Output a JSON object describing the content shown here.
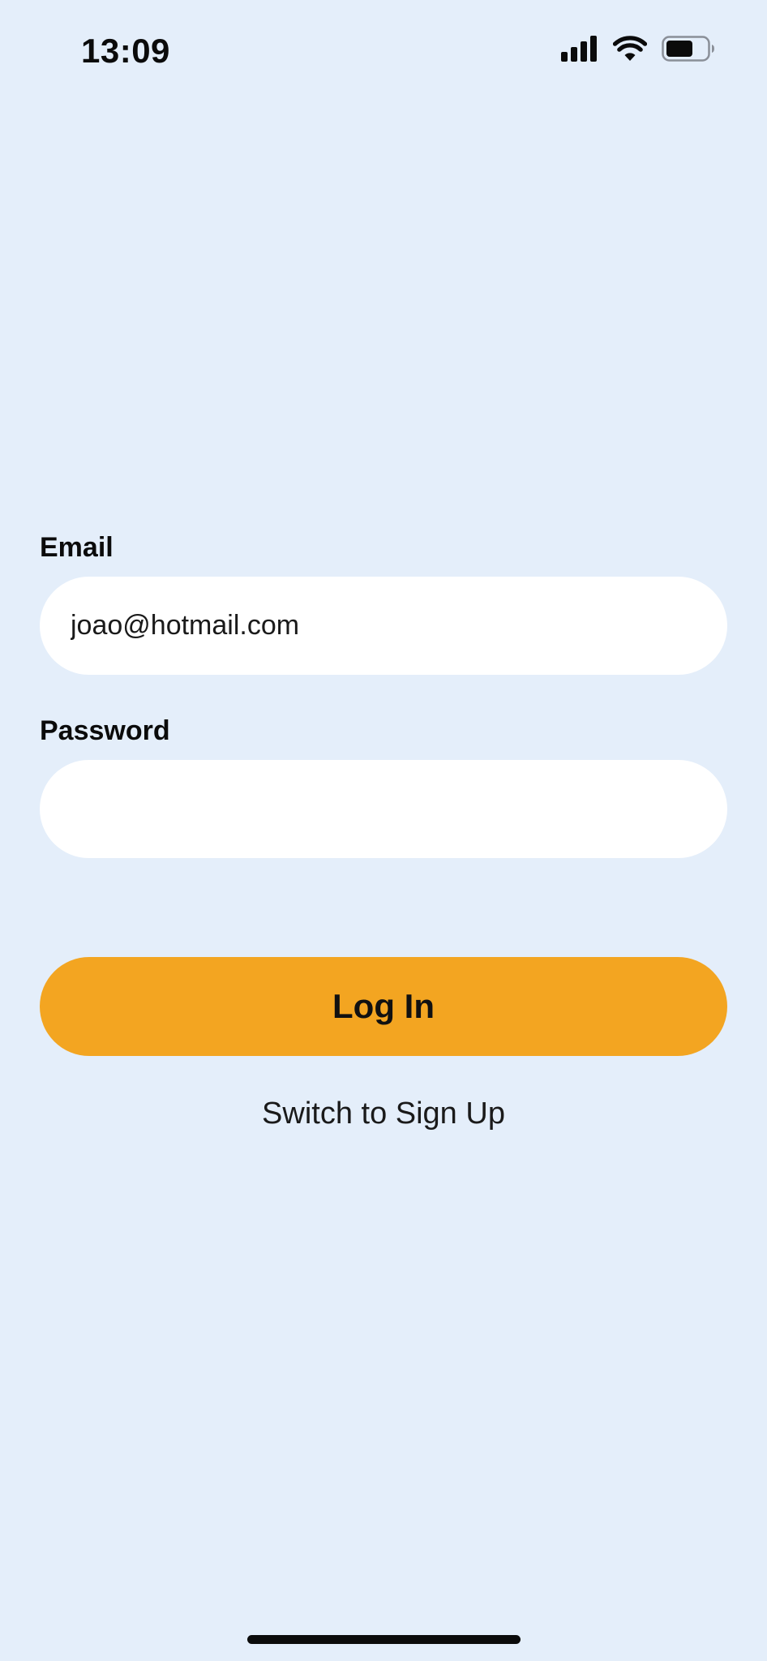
{
  "status_bar": {
    "time": "13:09",
    "icons": [
      "cellular-signal-icon",
      "wifi-icon",
      "battery-icon"
    ]
  },
  "login_form": {
    "email_label": "Email",
    "email_value": "joao@hotmail.com",
    "password_label": "Password",
    "password_value": "",
    "login_button_label": "Log In",
    "switch_label": "Switch to Sign Up"
  },
  "colors": {
    "background": "#E4EEFA",
    "input_background": "#FFFFFF",
    "accent": "#F3A521",
    "text": "#0B0B0B"
  }
}
